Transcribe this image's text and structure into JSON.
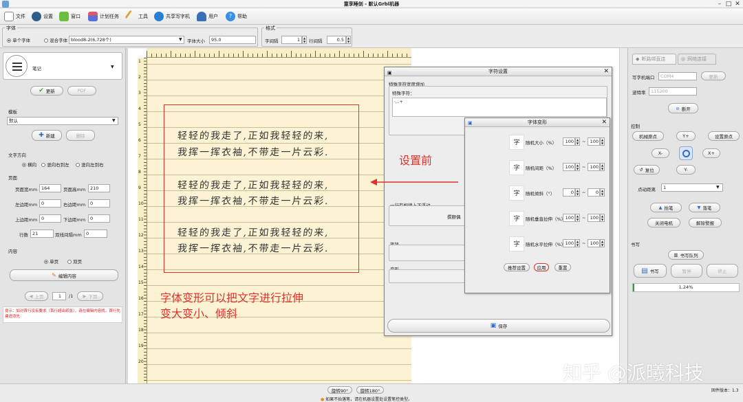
{
  "window": {
    "title": "童享睡剑 - 默认Grbl机器",
    "minimize": "–",
    "maximize": "□",
    "close": "✕"
  },
  "menu": {
    "file": "文件",
    "settings": "设置",
    "window": "窗口",
    "tasks": "计划任务",
    "tools": "工具",
    "share": "共享写字机",
    "user": "用户",
    "help": "帮助"
  },
  "font_group": {
    "label": "字体",
    "single": "单个字体",
    "mixed": "混合字体",
    "font_value": "blood8-2(6,728个)",
    "size_label": "字体大小",
    "size_value": "95.0"
  },
  "format_group": {
    "label": "格式",
    "char_spacing_label": "字间隔",
    "char_spacing": "1",
    "line_spacing_label": "行间隔",
    "line_spacing": "0.5"
  },
  "left": {
    "notebook": "笔记",
    "update_btn": "更新",
    "pdf_btn": "PDF",
    "template_label": "模板",
    "template_value": "默认",
    "new_btn": "新建",
    "delete_btn": "删除",
    "direction_label": "文字方向",
    "dir_h": "横向",
    "dir_rl": "竖向右到左",
    "dir_lr": "竖向左到右",
    "page_label": "页面",
    "page_w_label": "页面宽mm",
    "page_w": "164",
    "page_h_label": "页面高mm",
    "page_h": "210",
    "margin_l_label": "左边距mm",
    "margin_l": "0",
    "margin_r_label": "右边距mm",
    "margin_r": "0",
    "margin_t_label": "上边距mm",
    "margin_t": "0",
    "margin_b_label": "下边距mm",
    "margin_b": "0",
    "rows_label": "行数",
    "rows": "21",
    "row_space_label": "双线间隔mm",
    "row_space": "0",
    "content_label": "内容",
    "single_page": "单页",
    "double_page": "双页",
    "edit_btn": "编辑内容",
    "prev_btn": "上页",
    "page_num": "1",
    "page_total": "/1",
    "next_btn": "下页",
    "tip": "提示：如对首行没有要求（首行超出纸张），请在编辑内容找，首行先建造添先"
  },
  "paper": {
    "rulers_left": [
      "1",
      "2",
      "3",
      "4",
      "5",
      "6",
      "7",
      "8",
      "9",
      "10",
      "11",
      "12",
      "13",
      "14",
      "15",
      "16",
      "17",
      "18",
      "19",
      "20"
    ],
    "lines": [
      "轻轻的我走了,正如我轻轻的来,",
      "我挥一挥衣袖,不带走一片云彩.",
      "轻轻的我走了,正如我轻轻的来,",
      "我挥一挥衣袖,不带走一片云彩.",
      "轻轻的我走了,正如我轻轻的来,",
      "我挥一挥衣袖,不带走一片云彩."
    ]
  },
  "annotations": {
    "before": "设置前",
    "desc_line1": "字体变形可以把文字进行拉伸",
    "desc_line2": "变大变小、倾斜"
  },
  "char_settings": {
    "title": "字符设置",
    "special_group": "特殊字符宽度增加",
    "special_label": "特殊字符：",
    "special_value": "·,..+",
    "float_label": "一行有规律上下浮动",
    "sample_label": "撰颤偶",
    "pen_label": "笔锋",
    "deform_label": "变形",
    "save_btn": "保存"
  },
  "deform": {
    "title": "字体变形",
    "rows": [
      {
        "label": "随机大小（%）",
        "min": "100",
        "max": "100"
      },
      {
        "label": "随机间距（%）",
        "min": "100",
        "max": "100"
      },
      {
        "label": "随机倾斜（°）",
        "min": "0",
        "max": "0"
      },
      {
        "label": "随机垂直拉伸（%）",
        "min": "100",
        "max": "100"
      },
      {
        "label": "随机水平拉伸（%）",
        "min": "100",
        "max": "100"
      }
    ],
    "tilde": "~",
    "recommend_btn": "推荐设置",
    "apply_btn": "应用",
    "reset_btn": "重置"
  },
  "right": {
    "tab_connect": "断路绑直连",
    "tab_net": "网络连接",
    "port_label": "写字机端口",
    "port_value": "COM4",
    "refresh_btn": "更新",
    "baud_label": "波特率",
    "baud_value": "115200",
    "disconnect_btn": "断开",
    "control_label": "控制",
    "set_origin_btn": "机械原点",
    "y_plus": "Y+",
    "set_origin2_btn": "设置原点",
    "x_minus": "X-",
    "x_plus": "X+",
    "reset_btn": "复位",
    "y_minus": "Y-",
    "step_label": "点动距离",
    "step_value": "1",
    "pen_up_btn": "抬笔",
    "pen_down_btn": "落笔",
    "motor_off_btn": "关闭电机",
    "unlock_btn": "解除警报",
    "write_label": "书写",
    "queue_btn": "书写队列",
    "write_btn": "书写",
    "pause_btn": "暂停",
    "stop_btn": "终止",
    "progress": "1.24%"
  },
  "status": {
    "rotate90": "旋转90°",
    "rotate180": "旋转180°",
    "hint": "如果不抬落笔，请在机器设置处设置笔控类型。",
    "version": "固件版本：1.3"
  },
  "watermark": "知乎 @派曦科技",
  "colors": {
    "paper": "#fbf3d4",
    "annotation": "#e0322a",
    "accent": "#3a7fd0"
  }
}
